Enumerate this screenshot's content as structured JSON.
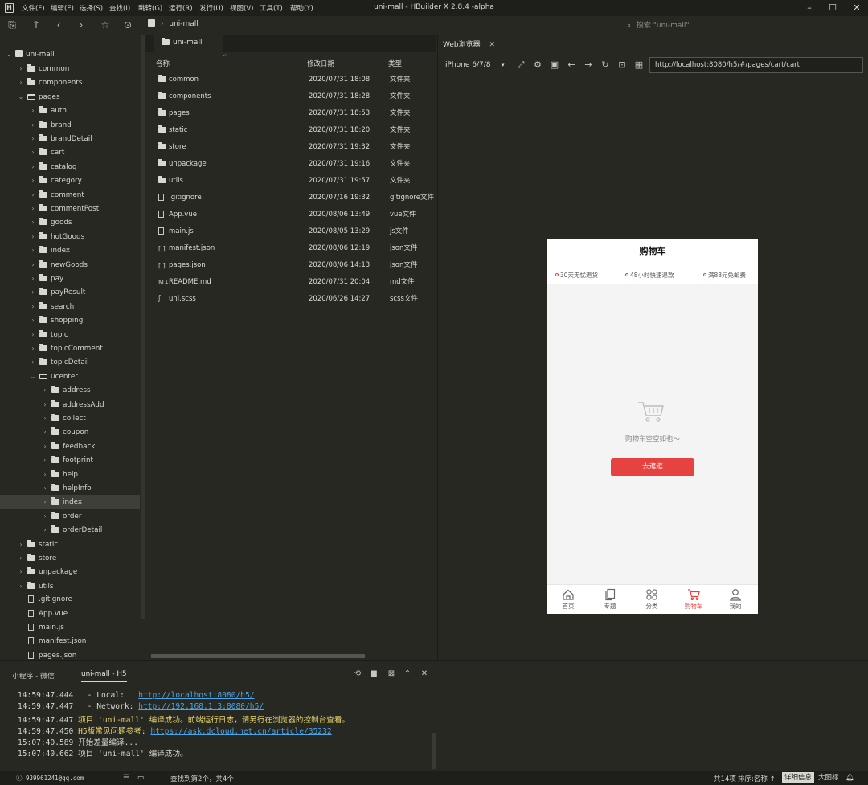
{
  "menu": [
    "文件(F)",
    "编辑(E)",
    "选择(S)",
    "查找(I)",
    "跳转(G)",
    "运行(R)",
    "发行(U)",
    "视图(V)",
    "工具(T)",
    "帮助(Y)"
  ],
  "window": {
    "title": "uni-mall - HBuilder X 2.8.4 -alpha"
  },
  "toolbar": {
    "breadcrumb_project": "uni-mall",
    "search_placeholder": "搜索 \"uni-mall\""
  },
  "sidebar": {
    "project": "uni-mall",
    "rows": [
      {
        "label": "common",
        "type": "folder",
        "depth": 1,
        "state": "closed"
      },
      {
        "label": "components",
        "type": "folder",
        "depth": 1,
        "state": "closed"
      },
      {
        "label": "pages",
        "type": "folder",
        "depth": 1,
        "state": "open"
      },
      {
        "label": "auth",
        "type": "folder",
        "depth": 2,
        "state": "closed"
      },
      {
        "label": "brand",
        "type": "folder",
        "depth": 2,
        "state": "closed"
      },
      {
        "label": "brandDetail",
        "type": "folder",
        "depth": 2,
        "state": "closed"
      },
      {
        "label": "cart",
        "type": "folder",
        "depth": 2,
        "state": "closed"
      },
      {
        "label": "catalog",
        "type": "folder",
        "depth": 2,
        "state": "closed"
      },
      {
        "label": "category",
        "type": "folder",
        "depth": 2,
        "state": "closed"
      },
      {
        "label": "comment",
        "type": "folder",
        "depth": 2,
        "state": "closed"
      },
      {
        "label": "commentPost",
        "type": "folder",
        "depth": 2,
        "state": "closed"
      },
      {
        "label": "goods",
        "type": "folder",
        "depth": 2,
        "state": "closed"
      },
      {
        "label": "hotGoods",
        "type": "folder",
        "depth": 2,
        "state": "closed"
      },
      {
        "label": "index",
        "type": "folder",
        "depth": 2,
        "state": "closed"
      },
      {
        "label": "newGoods",
        "type": "folder",
        "depth": 2,
        "state": "closed"
      },
      {
        "label": "pay",
        "type": "folder",
        "depth": 2,
        "state": "closed"
      },
      {
        "label": "payResult",
        "type": "folder",
        "depth": 2,
        "state": "closed"
      },
      {
        "label": "search",
        "type": "folder",
        "depth": 2,
        "state": "closed"
      },
      {
        "label": "shopping",
        "type": "folder",
        "depth": 2,
        "state": "closed"
      },
      {
        "label": "topic",
        "type": "folder",
        "depth": 2,
        "state": "closed"
      },
      {
        "label": "topicComment",
        "type": "folder",
        "depth": 2,
        "state": "closed"
      },
      {
        "label": "topicDetail",
        "type": "folder",
        "depth": 2,
        "state": "closed"
      },
      {
        "label": "ucenter",
        "type": "folder",
        "depth": 2,
        "state": "open"
      },
      {
        "label": "address",
        "type": "folder",
        "depth": 3,
        "state": "closed"
      },
      {
        "label": "addressAdd",
        "type": "folder",
        "depth": 3,
        "state": "closed"
      },
      {
        "label": "collect",
        "type": "folder",
        "depth": 3,
        "state": "closed"
      },
      {
        "label": "coupon",
        "type": "folder",
        "depth": 3,
        "state": "closed"
      },
      {
        "label": "feedback",
        "type": "folder",
        "depth": 3,
        "state": "closed"
      },
      {
        "label": "footprint",
        "type": "folder",
        "depth": 3,
        "state": "closed"
      },
      {
        "label": "help",
        "type": "folder",
        "depth": 3,
        "state": "closed"
      },
      {
        "label": "helpInfo",
        "type": "folder",
        "depth": 3,
        "state": "closed"
      },
      {
        "label": "index",
        "type": "folder",
        "depth": 3,
        "state": "closed",
        "selected": true
      },
      {
        "label": "order",
        "type": "folder",
        "depth": 3,
        "state": "closed"
      },
      {
        "label": "orderDetail",
        "type": "folder",
        "depth": 3,
        "state": "closed"
      },
      {
        "label": "static",
        "type": "folder",
        "depth": 1,
        "state": "closed"
      },
      {
        "label": "store",
        "type": "folder",
        "depth": 1,
        "state": "closed"
      },
      {
        "label": "unpackage",
        "type": "folder",
        "depth": 1,
        "state": "closed"
      },
      {
        "label": "utils",
        "type": "folder",
        "depth": 1,
        "state": "closed"
      },
      {
        "label": ".gitignore",
        "type": "file",
        "depth": 1
      },
      {
        "label": "App.vue",
        "type": "file",
        "depth": 1
      },
      {
        "label": "main.js",
        "type": "file",
        "depth": 1
      },
      {
        "label": "manifest.json",
        "type": "file",
        "depth": 1
      },
      {
        "label": "pages.json",
        "type": "file",
        "depth": 1
      }
    ]
  },
  "center": {
    "tab_label": "uni-mall",
    "headers": {
      "name": "名称",
      "date": "修改日期",
      "type": "类型"
    },
    "files": [
      {
        "name": "common",
        "date": "2020/07/31 18:08",
        "type": "文件夹",
        "icon": "folder-icon"
      },
      {
        "name": "components",
        "date": "2020/07/31 18:28",
        "type": "文件夹",
        "icon": "folder-icon"
      },
      {
        "name": "pages",
        "date": "2020/07/31 18:53",
        "type": "文件夹",
        "icon": "folder-icon"
      },
      {
        "name": "static",
        "date": "2020/07/31 18:20",
        "type": "文件夹",
        "icon": "folder-icon"
      },
      {
        "name": "store",
        "date": "2020/07/31 19:32",
        "type": "文件夹",
        "icon": "folder-icon"
      },
      {
        "name": "unpackage",
        "date": "2020/07/31 19:16",
        "type": "文件夹",
        "icon": "folder-icon"
      },
      {
        "name": "utils",
        "date": "2020/07/31 19:57",
        "type": "文件夹",
        "icon": "folder-icon"
      },
      {
        "name": ".gitignore",
        "date": "2020/07/16 19:32",
        "type": "gitignore文件",
        "icon": "file-icon"
      },
      {
        "name": "App.vue",
        "date": "2020/08/06 13:49",
        "type": "vue文件",
        "icon": "file-icon"
      },
      {
        "name": "main.js",
        "date": "2020/08/05 13:29",
        "type": "js文件",
        "icon": "file-icon"
      },
      {
        "name": "manifest.json",
        "date": "2020/08/06 12:19",
        "type": "json文件",
        "icon": "json-icon"
      },
      {
        "name": "pages.json",
        "date": "2020/08/06 14:13",
        "type": "json文件",
        "icon": "json-icon"
      },
      {
        "name": "README.md",
        "date": "2020/07/31 20:04",
        "type": "md文件",
        "icon": "markdown-icon"
      },
      {
        "name": "uni.scss",
        "date": "2020/06/26 14:27",
        "type": "scss文件",
        "icon": "scss-icon"
      }
    ]
  },
  "browser": {
    "tab_label": "Web浏览器",
    "device": "iPhone 6/7/8",
    "url": "http://localhost:8080/h5/#/pages/cart/cart"
  },
  "phone": {
    "title": "购物车",
    "promos": [
      "30天无忧退货",
      "48小时快速退款",
      "满88元免邮费"
    ],
    "empty_text": "购物车空空如也～",
    "button": "去逛逛",
    "tabs": [
      {
        "label": "首页",
        "icon": "home-icon"
      },
      {
        "label": "专题",
        "icon": "topic-icon"
      },
      {
        "label": "分类",
        "icon": "category-icon"
      },
      {
        "label": "购物车",
        "icon": "cart-icon",
        "active": true
      },
      {
        "label": "我的",
        "icon": "user-icon"
      }
    ],
    "accent": "#e64340"
  },
  "console": {
    "tabs": [
      "小程序 - 微信",
      "uni-mall - H5"
    ],
    "lines": [
      {
        "time": "14:59:47.444",
        "text": "  - Local:   ",
        "link": "http://localhost:8080/h5/"
      },
      {
        "time": "14:59:47.447",
        "text": "  - Network: ",
        "link": "http://192.168.1.3:8080/h5/"
      },
      {
        "time": "14:59:47.447",
        "text": "项目 'uni-mall' 编译成功。前端运行日志，请另行在浏览器的控制台查看。",
        "yellow": true
      },
      {
        "time": "14:59:47.450",
        "text": "H5版常见问题参考: ",
        "link": "https://ask.dcloud.net.cn/article/35232",
        "yellow": true
      },
      {
        "time": "15:07:40.589",
        "text": "开始差量编译..."
      },
      {
        "time": "15:07:40.662",
        "text": "项目 'uni-mall' 编译成功。"
      }
    ]
  },
  "statusbar": {
    "user": "939961241@qq.com",
    "find_result": "查找到第2个，共4个",
    "count": "共14项",
    "sort": "排序:名称",
    "details": "详细信息",
    "large_icons": "大图标"
  }
}
